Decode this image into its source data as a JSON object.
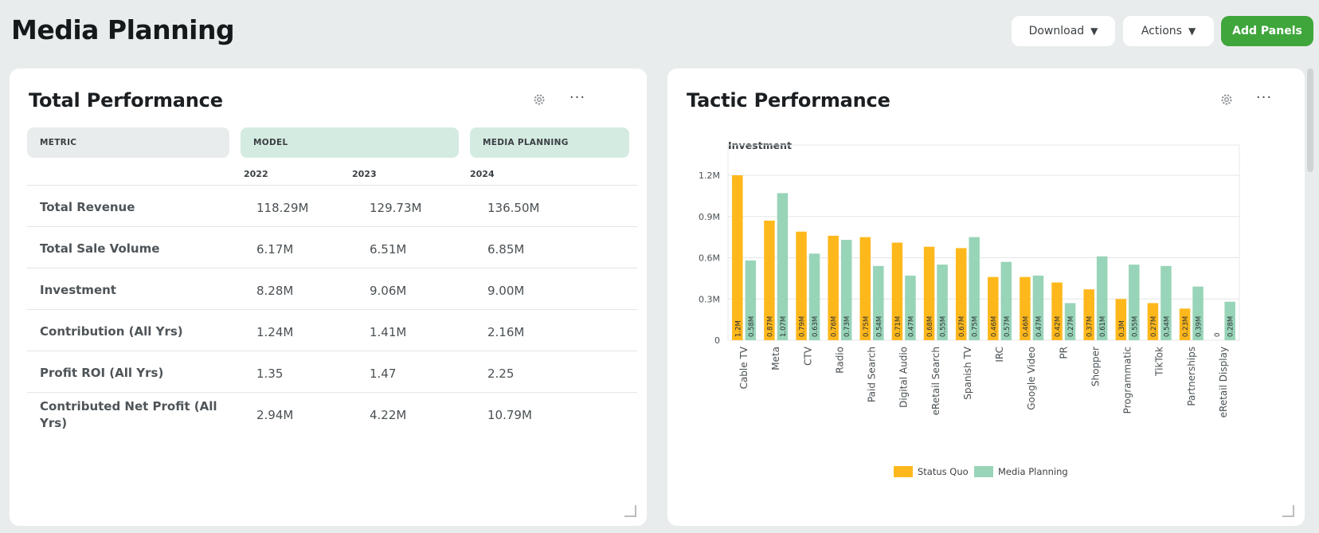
{
  "header": {
    "title": "Media Planning",
    "download_label": "Download",
    "actions_label": "Actions",
    "add_panels_label": "Add Panels"
  },
  "colors": {
    "accent_green": "#3fa63c",
    "status_quo": "#ffb81c",
    "media_planning": "#98d4b8",
    "header_teal": "#d4ebe1"
  },
  "left_panel": {
    "title": "Total Performance",
    "icons": [
      "gear-icon",
      "more-icon",
      "resize-handle-icon"
    ],
    "headers": {
      "metric": "METRIC",
      "model": "MODEL",
      "media_planning": "MEDIA PLANNING"
    },
    "years": [
      "2022",
      "2023",
      "2024"
    ],
    "rows": [
      {
        "metric": "Total Revenue",
        "values": [
          "118.29M",
          "129.73M",
          "136.50M"
        ]
      },
      {
        "metric": "Total Sale Volume",
        "values": [
          "6.17M",
          "6.51M",
          "6.85M"
        ]
      },
      {
        "metric": "Investment",
        "values": [
          "8.28M",
          "9.06M",
          "9.00M"
        ]
      },
      {
        "metric": "Contribution (All Yrs)",
        "values": [
          "1.24M",
          "1.41M",
          "2.16M"
        ]
      },
      {
        "metric": "Profit ROI (All Yrs)",
        "values": [
          "1.35",
          "1.47",
          "2.25"
        ]
      },
      {
        "metric": "Contributed Net Profit (All Yrs)",
        "values": [
          "2.94M",
          "4.22M",
          "10.79M"
        ]
      }
    ]
  },
  "right_panel": {
    "title": "Tactic Performance",
    "icons": [
      "gear-icon",
      "more-icon",
      "resize-handle-icon"
    ]
  },
  "chart_data": {
    "type": "bar",
    "title": "Investment",
    "ylabel": "",
    "xlabel": "",
    "ylim": [
      0,
      1.2
    ],
    "y_ticks": [
      "0",
      "0.3M",
      "0.6M",
      "0.9M",
      "1.2M"
    ],
    "y_tick_values": [
      0,
      0.3,
      0.6,
      0.9,
      1.2
    ],
    "grid": true,
    "legend_position": "bottom",
    "categories": [
      "Cable TV",
      "Meta",
      "CTV",
      "Radio",
      "Paid Search",
      "Digital Audio",
      "eRetail Search",
      "Spanish TV",
      "IRC",
      "Google Video",
      "PR",
      "Shopper",
      "Programmatic",
      "TikTok",
      "Partnerships",
      "eRetail Display"
    ],
    "series": [
      {
        "name": "Status Quo",
        "color": "#ffb81c",
        "values": [
          1.2,
          0.87,
          0.79,
          0.76,
          0.75,
          0.71,
          0.68,
          0.67,
          0.46,
          0.46,
          0.42,
          0.37,
          0.3,
          0.27,
          0.23,
          0
        ],
        "labels": [
          "1.2M",
          "0.87M",
          "0.79M",
          "0.76M",
          "0.75M",
          "0.71M",
          "0.68M",
          "0.67M",
          "0.46M",
          "0.46M",
          "0.42M",
          "0.37M",
          "0.3M",
          "0.27M",
          "0.23M",
          "0"
        ]
      },
      {
        "name": "Media Planning",
        "color": "#98d4b8",
        "values": [
          0.58,
          1.07,
          0.63,
          0.73,
          0.54,
          0.47,
          0.55,
          0.75,
          0.57,
          0.47,
          0.27,
          0.61,
          0.55,
          0.54,
          0.39,
          0.28
        ],
        "labels": [
          "0.58M",
          "1.07M",
          "0.63M",
          "0.73M",
          "0.54M",
          "0.47M",
          "0.55M",
          "0.75M",
          "0.57M",
          "0.47M",
          "0.27M",
          "0.61M",
          "0.55M",
          "0.54M",
          "0.39M",
          "0.28M"
        ]
      }
    ]
  }
}
